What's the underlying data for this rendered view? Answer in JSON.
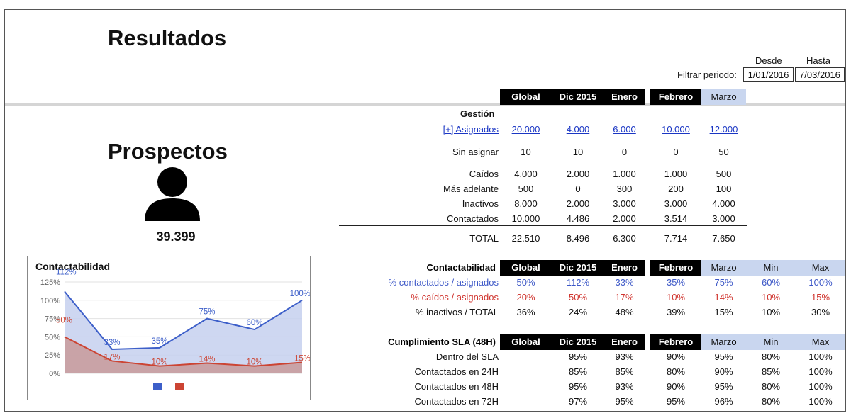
{
  "header": {
    "title": "Resultados",
    "filter": {
      "label": "Filtrar periodo:",
      "from_label": "Desde",
      "to_label": "Hasta",
      "from_value": "1/01/2016",
      "to_value": "7/03/2016"
    }
  },
  "prospectos": {
    "title": "Prospectos",
    "count": "39.399",
    "icon": "person-icon"
  },
  "columns": [
    "Global",
    "Dic 2015",
    "Enero",
    "Febrero",
    "Marzo"
  ],
  "gestion": {
    "section_label": "Gestión",
    "asignados": {
      "label": "[+] Asignados",
      "values": [
        "20.000",
        "4.000",
        "6.000",
        "10.000",
        "12.000"
      ]
    },
    "sin_asignar": {
      "label": "Sin asignar",
      "values": [
        "10",
        "10",
        "0",
        "0",
        "50"
      ]
    },
    "rows": [
      {
        "label": "Caídos",
        "values": [
          "4.000",
          "2.000",
          "1.000",
          "1.000",
          "500"
        ]
      },
      {
        "label": "Más adelante",
        "values": [
          "500",
          "0",
          "300",
          "200",
          "100"
        ]
      },
      {
        "label": "Inactivos",
        "values": [
          "8.000",
          "2.000",
          "3.000",
          "3.000",
          "4.000"
        ]
      },
      {
        "label": "Contactados",
        "values": [
          "10.000",
          "4.486",
          "2.000",
          "3.514",
          "3.000"
        ]
      }
    ],
    "total": {
      "label": "TOTAL",
      "values": [
        "22.510",
        "8.496",
        "6.300",
        "7.714",
        "7.650"
      ]
    }
  },
  "contactabilidad": {
    "title": "Contactabilidad",
    "headers": [
      "Global",
      "Dic 2015",
      "Enero",
      "Febrero",
      "Marzo",
      "Min",
      "Max"
    ],
    "rows": [
      {
        "label": "% contactados / asignados",
        "values": [
          "50%",
          "112%",
          "33%",
          "35%",
          "75%",
          "60%",
          "100%"
        ]
      },
      {
        "label": "% caídos / asignados",
        "values": [
          "20%",
          "50%",
          "17%",
          "10%",
          "14%",
          "10%",
          "15%"
        ]
      },
      {
        "label": "% inactivos / TOTAL",
        "values": [
          "36%",
          "24%",
          "48%",
          "39%",
          "15%",
          "10%",
          "30%"
        ]
      }
    ]
  },
  "sla": {
    "title": "Cumplimiento SLA (48H)",
    "headers": [
      "Global",
      "Dic 2015",
      "Enero",
      "Febrero",
      "Marzo",
      "Min",
      "Max"
    ],
    "rows": [
      {
        "label": "Dentro del SLA",
        "values": [
          "",
          "95%",
          "93%",
          "90%",
          "95%",
          "80%",
          "100%"
        ]
      },
      {
        "label": "Contactados en 24H",
        "values": [
          "",
          "85%",
          "85%",
          "80%",
          "90%",
          "85%",
          "100%"
        ]
      },
      {
        "label": "Contactados en 48H",
        "values": [
          "",
          "95%",
          "93%",
          "90%",
          "95%",
          "80%",
          "100%"
        ]
      },
      {
        "label": "Contactados en 72H",
        "values": [
          "",
          "97%",
          "95%",
          "95%",
          "96%",
          "80%",
          "100%"
        ]
      }
    ]
  },
  "chart_data": {
    "type": "area",
    "title": "Contactabilidad",
    "xlabel": "",
    "ylabel": "",
    "ylim": [
      0,
      125
    ],
    "yticks": [
      "0%",
      "25%",
      "50%",
      "75%",
      "100%",
      "125%"
    ],
    "grid": true,
    "series": [
      {
        "values": [
          112,
          33,
          35,
          75,
          60,
          100
        ],
        "labels": [
          "112%",
          "33%",
          "35%",
          "75%",
          "60%",
          "100%"
        ],
        "color": "#3d5fc9",
        "fill": "#c6d0ee"
      },
      {
        "values": [
          50,
          17,
          10,
          14,
          10,
          15
        ],
        "labels": [
          "50%",
          "17%",
          "10%",
          "14%",
          "10%",
          "15%"
        ],
        "color": "#cc4433",
        "fill": "#c89a9a"
      }
    ],
    "legend": {
      "position": "bottom",
      "colors": [
        "#3d5fc9",
        "#cc4433"
      ]
    }
  },
  "colors": {
    "header_dark": "#000000",
    "header_light": "#c9d6ef",
    "link": "#1a36c4",
    "blue_text": "#3d58c7",
    "red_text": "#d0352f"
  }
}
